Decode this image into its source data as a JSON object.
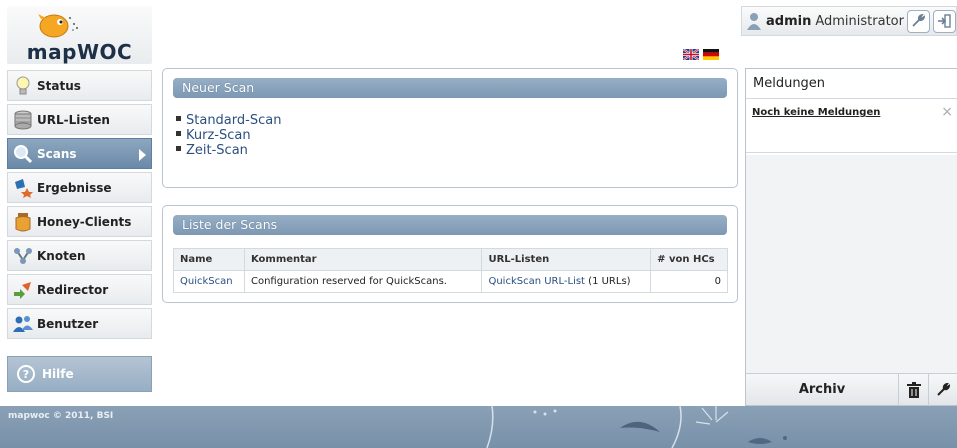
{
  "logo": {
    "text": "mapWOC"
  },
  "nav": [
    {
      "label": "Status",
      "icon": "lightbulb-icon"
    },
    {
      "label": "URL-Listen",
      "icon": "database-icon"
    },
    {
      "label": "Scans",
      "icon": "magnifier-icon",
      "active": true
    },
    {
      "label": "Ergebnisse",
      "icon": "results-icon"
    },
    {
      "label": "Honey-Clients",
      "icon": "honeypot-icon"
    },
    {
      "label": "Knoten",
      "icon": "nodes-icon"
    },
    {
      "label": "Redirector",
      "icon": "redirect-arrows-icon"
    },
    {
      "label": "Benutzer",
      "icon": "users-icon"
    }
  ],
  "help": {
    "label": "Hilfe",
    "icon": "help-icon"
  },
  "user": {
    "name": "admin",
    "role": "Administrator"
  },
  "languages": [
    "en",
    "de"
  ],
  "new_scan": {
    "title": "Neuer Scan",
    "links": [
      "Standard-Scan",
      "Kurz-Scan",
      "Zeit-Scan"
    ]
  },
  "scan_list": {
    "title": "Liste der Scans",
    "columns": [
      "Name",
      "Kommentar",
      "URL-Listen",
      "# von HCs"
    ],
    "rows": [
      {
        "name": "QuickScan",
        "comment": "Configuration reserved for QuickScans.",
        "url_list": "QuickScan URL-List",
        "url_count": "(1 URLs)",
        "hcs": "0"
      }
    ]
  },
  "messages": {
    "title": "Meldungen",
    "empty_text": "Noch keine Meldungen",
    "archive_label": "Archiv"
  },
  "footer": {
    "text": "mapwoc © 2011, BSI"
  },
  "colors": {
    "accent": "#7d98b3",
    "link": "#2a4f80",
    "footer": "#8aa0b6"
  }
}
